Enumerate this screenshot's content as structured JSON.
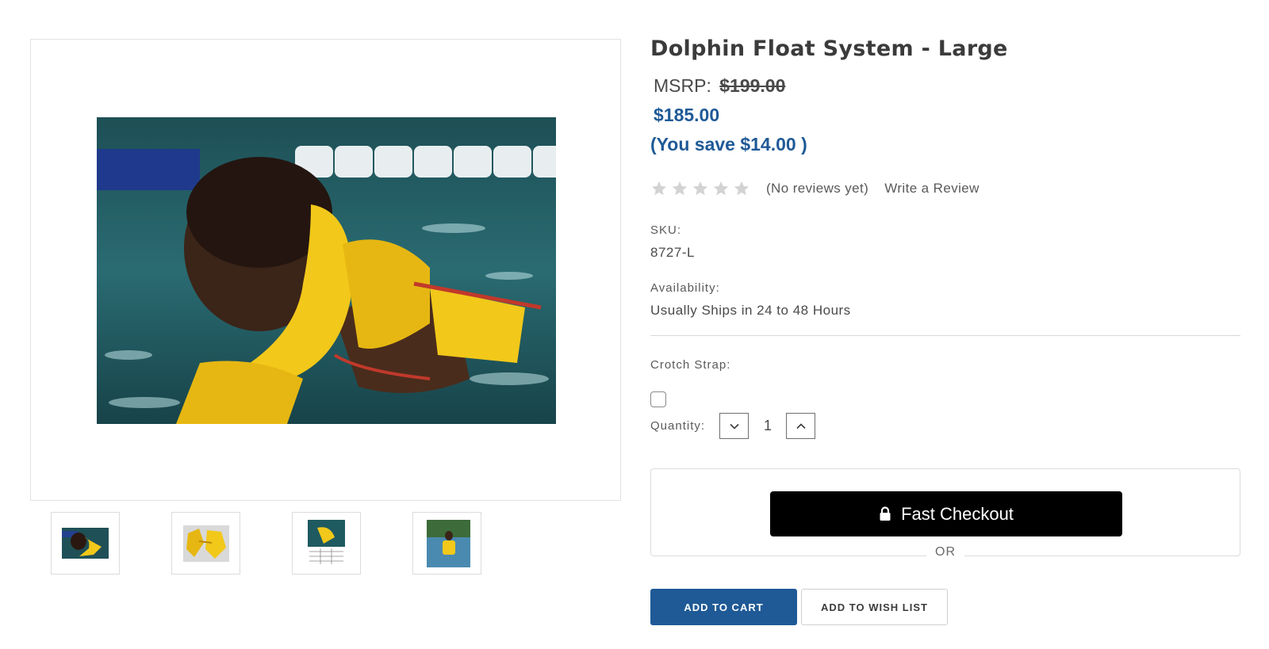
{
  "product": {
    "title": "Dolphin Float System - Large",
    "msrp_label": "MSRP:",
    "msrp_value": "$199.00",
    "price": "$185.00",
    "savings": "(You save $14.00 )",
    "rating": {
      "stars_filled": 0,
      "stars_total": 5,
      "reviews_text": "(No reviews yet)",
      "write_review_label": "Write a Review"
    },
    "sku_label": "SKU:",
    "sku_value": "8727-L",
    "availability_label": "Availability:",
    "availability_value": "Usually Ships in 24 to 48 Hours",
    "options": {
      "crotch_strap_label": "Crotch Strap:",
      "crotch_strap_checked": false
    },
    "quantity_label": "Quantity:",
    "quantity_value": "1"
  },
  "gallery": {
    "main_image": "boy-swimming-in-yellow-float-vest",
    "thumbnails": [
      {
        "image": "boy-swimming-in-yellow-float-vest",
        "selected": true
      },
      {
        "image": "yellow-float-vest-pieces"
      },
      {
        "image": "float-size-chart"
      },
      {
        "image": "child-standing-in-lake-with-float"
      }
    ]
  },
  "checkout": {
    "fast_checkout_label": "Fast Checkout",
    "fast_checkout_icon": "lock-icon",
    "or_label": "OR",
    "add_to_cart_label": "ADD TO CART",
    "add_to_wishlist_label": "ADD TO WISH LIST"
  },
  "colors": {
    "brand_blue": "#1f5a96",
    "star_empty": "#d3d3d3",
    "checkout_black": "#000000"
  }
}
